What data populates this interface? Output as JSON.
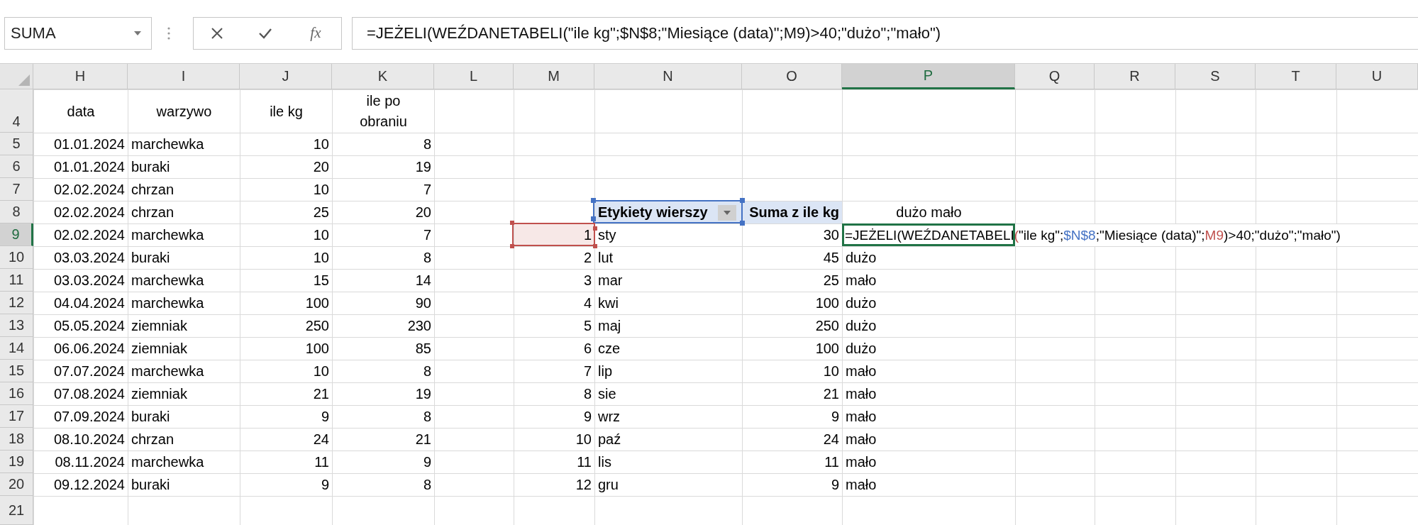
{
  "formula_bar": {
    "name_box": "SUMA",
    "function_label": "fx",
    "formula": "=JEŻELI(WEŹDANETABELI(\"ile kg\";$N$8;\"Miesiące (data)\";M9)>40;\"dużo\";\"mało\")"
  },
  "columns": [
    {
      "label": "H",
      "selected": false
    },
    {
      "label": "I",
      "selected": false
    },
    {
      "label": "J",
      "selected": false
    },
    {
      "label": "K",
      "selected": false
    },
    {
      "label": "L",
      "selected": false
    },
    {
      "label": "M",
      "selected": false
    },
    {
      "label": "N",
      "selected": false
    },
    {
      "label": "O",
      "selected": false
    },
    {
      "label": "P",
      "selected": true
    },
    {
      "label": "Q",
      "selected": false
    },
    {
      "label": "R",
      "selected": false
    },
    {
      "label": "S",
      "selected": false
    },
    {
      "label": "T",
      "selected": false
    },
    {
      "label": "U",
      "selected": false
    }
  ],
  "rows": [
    {
      "header": "4",
      "selected": false,
      "kind": "column_titles",
      "cells": {
        "h": "data",
        "i": "warzywo",
        "j": "ile kg",
        "k": "ile po obraniu"
      }
    },
    {
      "header": "5",
      "selected": false,
      "kind": "data",
      "cells": {
        "h": "01.01.2024",
        "i": "marchewka",
        "j": "10",
        "k": "8"
      }
    },
    {
      "header": "6",
      "selected": false,
      "kind": "data",
      "cells": {
        "h": "01.01.2024",
        "i": "buraki",
        "j": "20",
        "k": "19"
      }
    },
    {
      "header": "7",
      "selected": false,
      "kind": "data",
      "cells": {
        "h": "02.02.2024",
        "i": "chrzan",
        "j": "10",
        "k": "7"
      }
    },
    {
      "header": "8",
      "selected": false,
      "kind": "pivot_header",
      "cells": {
        "h": "02.02.2024",
        "i": "chrzan",
        "j": "25",
        "k": "20",
        "n": {
          "text": "Etykiety wierszy",
          "color": "#4472c4"
        },
        "o": "Suma z ile kg",
        "p": "dużo mało"
      }
    },
    {
      "header": "9",
      "selected": true,
      "kind": "editing",
      "cells": {
        "h": "02.02.2024",
        "i": "marchewka",
        "j": "10",
        "k": "7",
        "m": {
          "text": "1",
          "color": "#c0504d"
        },
        "n": "sty",
        "o": "30"
      },
      "formula_segments": [
        {
          "text": "=JEŻELI(WEŹDANETABELI",
          "color": "#000000"
        },
        {
          "text": "(",
          "color": "#c0504d"
        },
        {
          "text": "\"ile kg\";",
          "color": "#000000"
        },
        {
          "text": "$N$8",
          "color": "#4472c4"
        },
        {
          "text": ";\"Miesiące (data)\";",
          "color": "#000000"
        },
        {
          "text": "M9",
          "color": "#c0504d"
        },
        {
          "text": ")>40;\"dużo\";\"mało\")",
          "color": "#000000"
        }
      ]
    },
    {
      "header": "10",
      "selected": false,
      "kind": "data",
      "cells": {
        "h": "03.03.2024",
        "i": "buraki",
        "j": "10",
        "k": "8",
        "m": "2",
        "n": "lut",
        "o": "45",
        "p": "dużo"
      }
    },
    {
      "header": "11",
      "selected": false,
      "kind": "data",
      "cells": {
        "h": "03.03.2024",
        "i": "marchewka",
        "j": "15",
        "k": "14",
        "m": "3",
        "n": "mar",
        "o": "25",
        "p": "mało"
      }
    },
    {
      "header": "12",
      "selected": false,
      "kind": "data",
      "cells": {
        "h": "04.04.2024",
        "i": "marchewka",
        "j": "100",
        "k": "90",
        "m": "4",
        "n": "kwi",
        "o": "100",
        "p": "dużo"
      }
    },
    {
      "header": "13",
      "selected": false,
      "kind": "data",
      "cells": {
        "h": "05.05.2024",
        "i": "ziemniak",
        "j": "250",
        "k": "230",
        "m": "5",
        "n": "maj",
        "o": "250",
        "p": "dużo"
      }
    },
    {
      "header": "14",
      "selected": false,
      "kind": "data",
      "cells": {
        "h": "06.06.2024",
        "i": "ziemniak",
        "j": "100",
        "k": "85",
        "m": "6",
        "n": "cze",
        "o": "100",
        "p": "dużo"
      }
    },
    {
      "header": "15",
      "selected": false,
      "kind": "data",
      "cells": {
        "h": "07.07.2024",
        "i": "marchewka",
        "j": "10",
        "k": "8",
        "m": "7",
        "n": "lip",
        "o": "10",
        "p": "mało"
      }
    },
    {
      "header": "16",
      "selected": false,
      "kind": "data",
      "cells": {
        "h": "07.08.2024",
        "i": "ziemniak",
        "j": "21",
        "k": "19",
        "m": "8",
        "n": "sie",
        "o": "21",
        "p": "mało"
      }
    },
    {
      "header": "17",
      "selected": false,
      "kind": "data",
      "cells": {
        "h": "07.09.2024",
        "i": "buraki",
        "j": "9",
        "k": "8",
        "m": "9",
        "n": "wrz",
        "o": "9",
        "p": "mało"
      }
    },
    {
      "header": "18",
      "selected": false,
      "kind": "data",
      "cells": {
        "h": "08.10.2024",
        "i": "chrzan",
        "j": "24",
        "k": "21",
        "m": "10",
        "n": "paź",
        "o": "24",
        "p": "mało"
      }
    },
    {
      "header": "19",
      "selected": false,
      "kind": "data",
      "cells": {
        "h": "08.11.2024",
        "i": "marchewka",
        "j": "11",
        "k": "9",
        "m": "11",
        "n": "lis",
        "o": "11",
        "p": "mało"
      }
    },
    {
      "header": "20",
      "selected": false,
      "kind": "data",
      "cells": {
        "h": "09.12.2024",
        "i": "buraki",
        "j": "9",
        "k": "8",
        "m": "12",
        "n": "gru",
        "o": "9",
        "p": "mało"
      }
    },
    {
      "header": "21",
      "selected": false,
      "kind": "data",
      "cells": {}
    }
  ]
}
